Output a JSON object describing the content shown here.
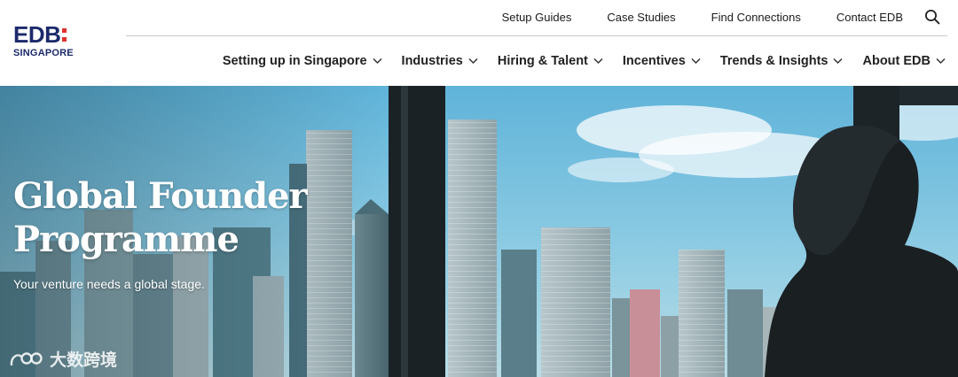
{
  "brand": {
    "name": "EDB",
    "subtitle": "SINGAPORE"
  },
  "utility_nav": {
    "links": [
      "Setup Guides",
      "Case Studies",
      "Find Connections",
      "Contact EDB"
    ],
    "search_icon": "search-icon"
  },
  "main_nav": {
    "items": [
      "Setting up in Singapore",
      "Industries",
      "Hiring & Talent",
      "Incentives",
      "Trends & Insights",
      "About EDB"
    ],
    "dropdown_icon": "chevron-down-icon"
  },
  "hero": {
    "title_line1": "Global Founder",
    "title_line2": "Programme",
    "subtitle": "Your venture needs a global stage."
  },
  "watermark": {
    "text": "大数跨境"
  },
  "colors": {
    "brand_navy": "#1c2a6b",
    "brand_red": "#e0312e",
    "nav_text": "#222222"
  }
}
